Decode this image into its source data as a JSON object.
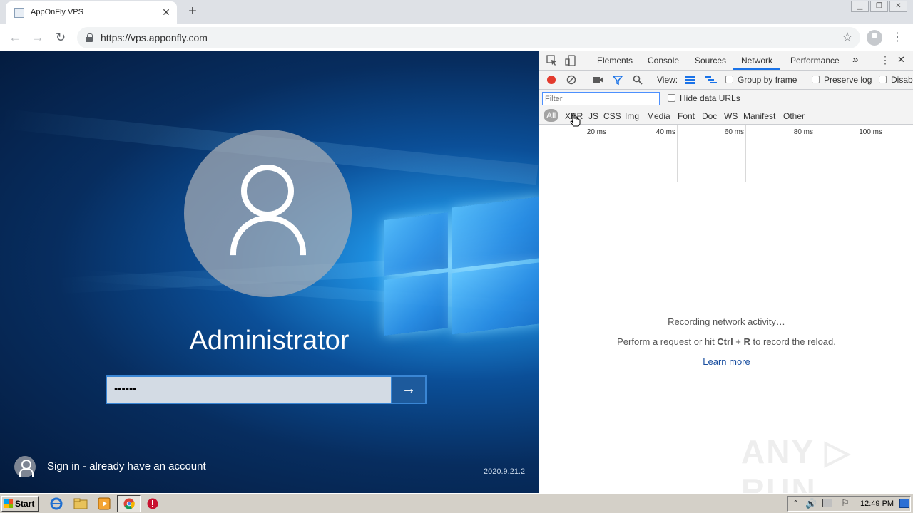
{
  "browser": {
    "tab_title": "AppOnFly VPS",
    "new_tab_glyph": "+",
    "close_tab_glyph": "✕",
    "url": "https://vps.apponfly.com",
    "back_glyph": "←",
    "forward_glyph": "→",
    "reload_glyph": "↻",
    "star_glyph": "☆",
    "menu_glyph": "⋮",
    "window_controls": [
      "▁",
      "❐",
      "✕"
    ]
  },
  "login": {
    "username": "Administrator",
    "password_mask": "••••••",
    "submit_glyph": "→",
    "alt_signin": "Sign in - already have an account",
    "version": "2020.9.21.2"
  },
  "devtools": {
    "tabs": [
      "Elements",
      "Console",
      "Sources",
      "Network",
      "Performance"
    ],
    "active_tab": "Network",
    "more_glyph": "»",
    "close_glyph": "✕",
    "view_label": "View:",
    "group_by_frame": "Group by frame",
    "preserve_log": "Preserve log",
    "disable_cache": "Disab",
    "filter_placeholder": "Filter",
    "hide_data_urls": "Hide data URLs",
    "types": [
      "All",
      "XHR",
      "JS",
      "CSS",
      "Img",
      "Media",
      "Font",
      "Doc",
      "WS",
      "Manifest",
      "Other"
    ],
    "active_type": "All",
    "timeline_labels": [
      "20 ms",
      "40 ms",
      "60 ms",
      "80 ms",
      "100 ms"
    ],
    "recording": "Recording network activity…",
    "hint_pre": "Perform a request or hit ",
    "hint_key1": "Ctrl",
    "hint_plus": " + ",
    "hint_key2": "R",
    "hint_post": " to record the reload.",
    "learn_more": "Learn more"
  },
  "watermark": "ANY ▷ RUN",
  "taskbar": {
    "start": "Start",
    "clock": "12:49 PM"
  },
  "colors": {
    "record": "#e33b2e",
    "accent": "#1a73e8",
    "link": "#1a4fa0"
  }
}
